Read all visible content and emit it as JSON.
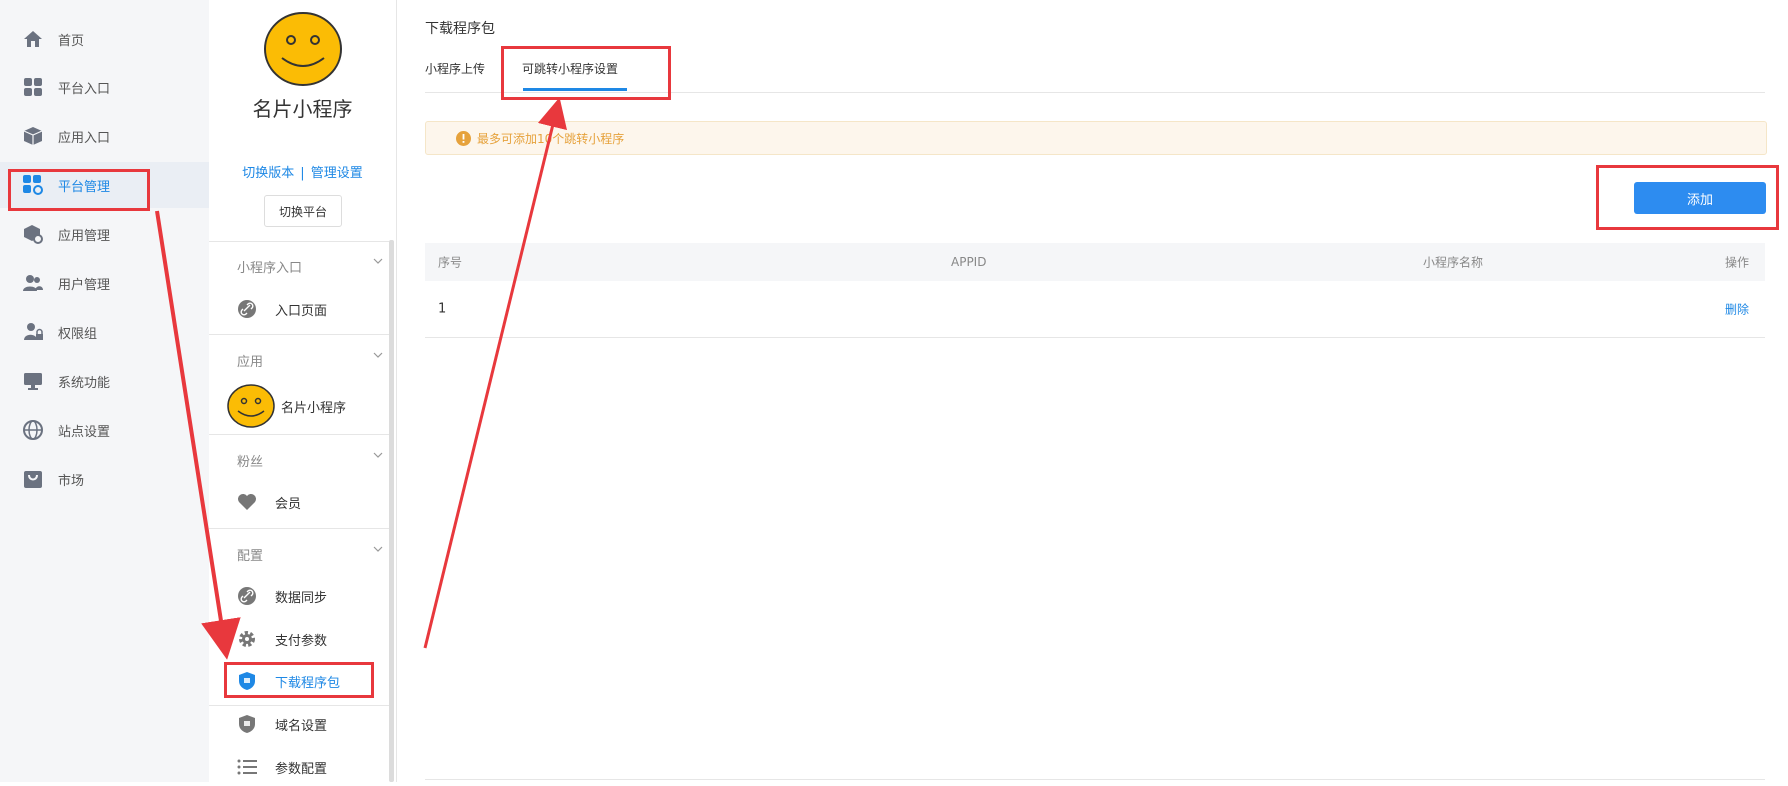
{
  "nav": {
    "items": [
      {
        "label": "首页",
        "icon": "home-icon"
      },
      {
        "label": "平台入口",
        "icon": "grid-icon"
      },
      {
        "label": "应用入口",
        "icon": "cube-icon"
      },
      {
        "label": "平台管理",
        "icon": "grid-gear-icon"
      },
      {
        "label": "应用管理",
        "icon": "cube-gear-icon"
      },
      {
        "label": "用户管理",
        "icon": "users-icon"
      },
      {
        "label": "权限组",
        "icon": "user-lock-icon"
      },
      {
        "label": "系统功能",
        "icon": "monitor-icon"
      },
      {
        "label": "站点设置",
        "icon": "globe-icon"
      },
      {
        "label": "市场",
        "icon": "shop-bag-icon"
      }
    ],
    "active_index": 3
  },
  "panel": {
    "app_name": "名片小程序",
    "switch_version": "切换版本",
    "separator": "|",
    "manage_settings": "管理设置",
    "switch_platform": "切换平台",
    "groups": {
      "miniprogram": {
        "title": "小程序入口",
        "items": [
          "入口页面"
        ]
      },
      "apps": {
        "title": "应用",
        "items": [
          "名片小程序"
        ]
      },
      "fans": {
        "title": "粉丝",
        "items": [
          "会员"
        ]
      },
      "config": {
        "title": "配置",
        "items": [
          "数据同步",
          "支付参数",
          "下载程序包",
          "域名设置",
          "参数配置"
        ]
      }
    }
  },
  "content": {
    "page_title": "下载程序包",
    "tabs": [
      "小程序上传",
      "可跳转小程序设置"
    ],
    "active_tab": 1,
    "alert": "最多可添加10个跳转小程序",
    "add_button": "添加",
    "table": {
      "headers": [
        "序号",
        "APPID",
        "小程序名称",
        "操作"
      ],
      "rows": [
        {
          "index": "1",
          "appid": "",
          "name": "",
          "action": "删除"
        }
      ]
    }
  },
  "colors": {
    "accent": "#1e88e5",
    "annotation_red": "#e8383d",
    "alert_text": "#e6a23c",
    "alert_bg": "#fdf6ec"
  }
}
